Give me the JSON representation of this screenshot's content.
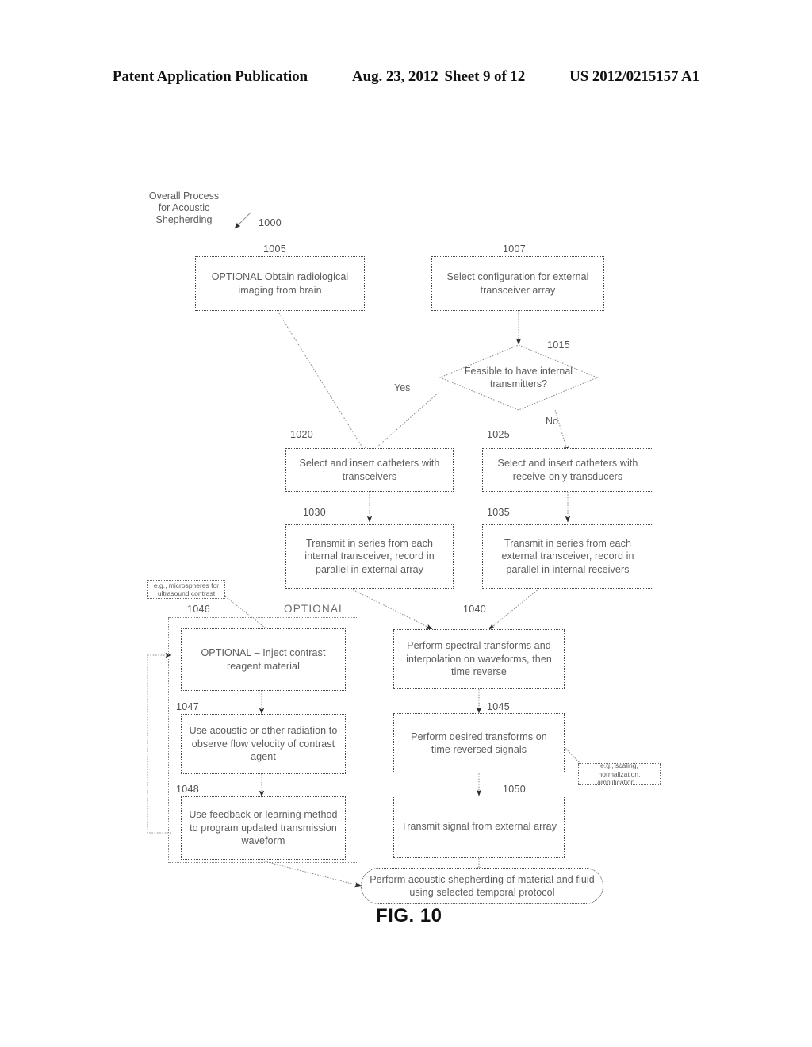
{
  "header": {
    "publication": "Patent Application Publication",
    "date": "Aug. 23, 2012",
    "sheet": "Sheet 9 of 12",
    "document_number": "US 2012/0215157 A1"
  },
  "figure": {
    "caption": "FIG. 10",
    "title_caption": "Overall Process\nfor Acoustic\nShepherding",
    "title_ref": "1000",
    "optional_group_title": "OPTIONAL"
  },
  "nodes": {
    "n1005": {
      "ref": "1005",
      "text": "OPTIONAL\nObtain radiological imaging\nfrom brain"
    },
    "n1007": {
      "ref": "1007",
      "text": "Select configuration for external\ntransceiver array"
    },
    "n1015": {
      "ref": "1015",
      "text": "Feasible to have\ninternal transmitters?"
    },
    "n1020": {
      "ref": "1020",
      "text": "Select and insert catheters with\ntransceivers"
    },
    "n1025": {
      "ref": "1025",
      "text": "Select and insert catheters with\nreceive-only transducers"
    },
    "n1030": {
      "ref": "1030",
      "text": "Transmit in series from each\ninternal transceiver, record in\nparallel in external array"
    },
    "n1035": {
      "ref": "1035",
      "text": "Transmit in series from each\nexternal transceiver, record in\nparallel in internal receivers"
    },
    "n1040": {
      "ref": "1040",
      "text": "Perform spectral transforms and\ninterpolation on waveforms,\nthen time reverse"
    },
    "n1045": {
      "ref": "1045",
      "text": "Perform desired transforms on\ntime reversed signals"
    },
    "n1046": {
      "ref": "1046",
      "text": "OPTIONAL – Inject contrast\nreagent material"
    },
    "n1047": {
      "ref": "1047",
      "text": "Use acoustic or other radiation\nto observe flow velocity of\ncontrast agent"
    },
    "n1048": {
      "ref": "1048",
      "text": "Use feedback or learning\nmethod to program updated\ntransmission waveform"
    },
    "n1050": {
      "ref": "1050",
      "text": "Transmit signal from external\narray"
    },
    "nfinal": {
      "ref": "",
      "text": "Perform acoustic shepherding of material and\nfluid using selected temporal protocol"
    }
  },
  "edge_labels": {
    "yes": "Yes",
    "no": "No"
  },
  "notes": {
    "contrast": "e.g., microspheres for\nultrasound contrast",
    "transforms": "e.g., scaling, normalization,\namplification…"
  }
}
